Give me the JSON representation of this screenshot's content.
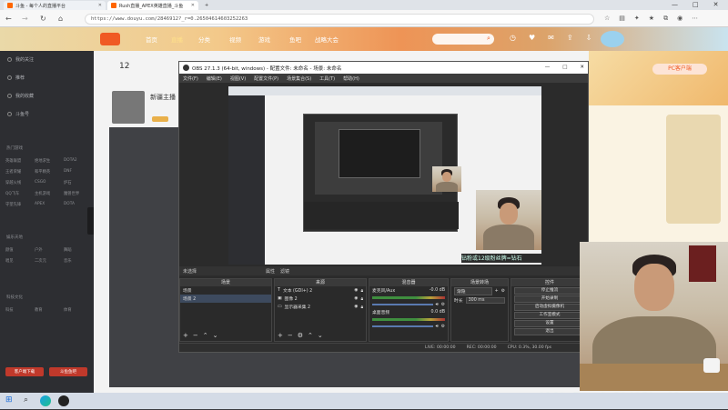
{
  "browser": {
    "tabs": [
      {
        "label": "斗鱼 - 每个人的直播平台"
      },
      {
        "label": "Rush直播_APEX英雄直播_斗鱼"
      },
      {
        "label": "+"
      }
    ],
    "url": "https://www.douyu.com/2846912?_r=0.26504614603252263"
  },
  "site": {
    "nav": [
      "首页",
      "直播",
      "分类",
      "视频",
      "游戏",
      "鱼吧",
      "战略大会"
    ],
    "badge_text": "PC客户端",
    "rank_number": "12",
    "streamer_title": "新疆主播"
  },
  "sidebar": {
    "items": [
      "我的关注",
      "推荐",
      "我的收藏",
      "斗鱼号"
    ],
    "groups": [
      "热门游戏",
      "娱乐天地",
      "科技文化"
    ],
    "grid": [
      "英雄联盟",
      "绝地求生",
      "DOTA2",
      "王者荣耀",
      "和平精英",
      "DNF",
      "穿越火线",
      "CSGO",
      "炉石",
      "QQ飞车",
      "主机游戏",
      "魔兽世界",
      "守望先锋",
      "APEX",
      "DOTA",
      "颜值",
      "户外",
      "舞蹈",
      "唱见",
      "二次元",
      "音乐",
      "科技",
      "教育",
      "体育"
    ],
    "btn_left": "客户端下载",
    "btn_right": "斗鱼鱼吧"
  },
  "obs": {
    "title": "OBS 27.1.3 (64-bit, windows) - 配置文件: 未命名 - 场景: 未命名",
    "menu": [
      "文件(F)",
      "编辑(E)",
      "视图(V)",
      "配置文件(P)",
      "场景集合(S)",
      "工具(T)",
      "帮助(H)"
    ],
    "scene_bar": [
      "未选择",
      "属性",
      "滤镜"
    ],
    "docks": {
      "scenes_title": "场景",
      "scenes": [
        "场景",
        "场景 2"
      ],
      "sources_title": "来源",
      "sources": [
        "文本 (GDI+) 2",
        "图像 2",
        "显示器采集 2"
      ],
      "mixer_title": "混音器",
      "mixer_channels": [
        "麦克风/Aux",
        "桌面音频"
      ],
      "mixer_db": [
        "-0.0 dB",
        "0.0 dB"
      ],
      "transition_title": "场景转场",
      "transition_type": "渐隐",
      "transition_duration_label": "时长",
      "transition_duration": "300 ms",
      "controls_title": "控件",
      "controls": [
        "停止推流",
        "开始录制",
        "启动虚拟摄像机",
        "工作室模式",
        "设置",
        "退出"
      ]
    },
    "status": {
      "live": "LIVE: 00:00:00",
      "rec": "REC: 00:00:00",
      "cpu": "CPU: 0.3%, 30.00 fps"
    }
  },
  "overlay_text": "钻粉或12级粉丝牌=钻石",
  "colors": {
    "accent": "#f05a24",
    "obs_bg": "#2b2b2b",
    "overlay": "#dcf5ea"
  },
  "taskbar": {
    "icons": [
      "windows-icon",
      "search-icon",
      "edge-icon",
      "obs-icon"
    ]
  }
}
